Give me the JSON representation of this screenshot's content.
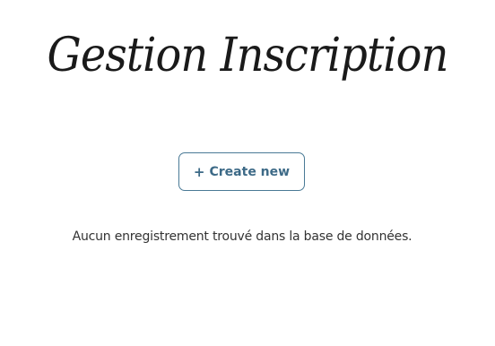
{
  "header": {
    "title": "Gestion Inscription"
  },
  "actions": {
    "create_label": "Create new",
    "create_icon": "+"
  },
  "content": {
    "empty_message": "Aucun enregistrement trouvé dans la base de données."
  },
  "colors": {
    "button_border": "#4a7a96",
    "button_text": "#3d6a87",
    "text": "#333333",
    "background": "#ffffff"
  }
}
